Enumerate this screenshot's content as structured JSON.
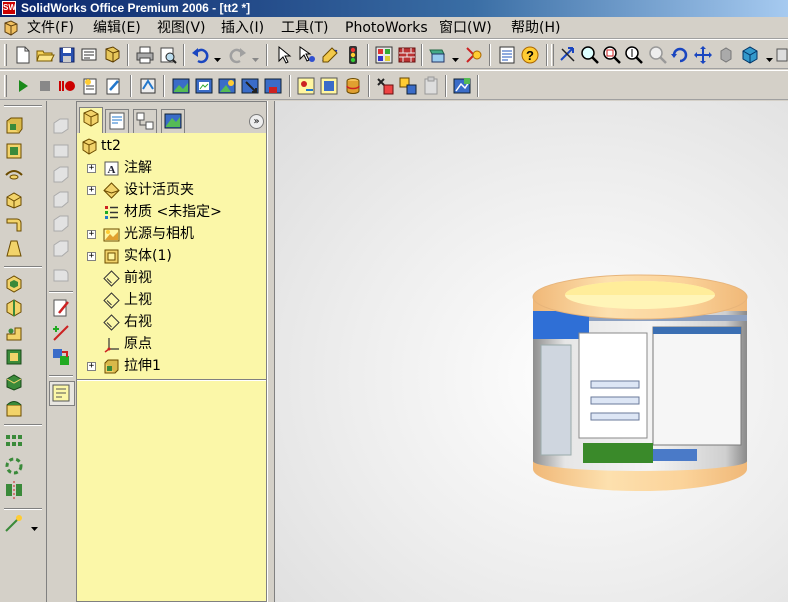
{
  "window": {
    "app_icon_text": "SW",
    "title": "SolidWorks Office Premium 2006 - [tt2 *]"
  },
  "menu": [
    {
      "label": "文件(F)"
    },
    {
      "label": "编辑(E)"
    },
    {
      "label": "视图(V)"
    },
    {
      "label": "插入(I)"
    },
    {
      "label": "工具(T)"
    },
    {
      "label": "PhotoWorks"
    },
    {
      "label": "窗口(W)"
    },
    {
      "label": "帮助(H)"
    }
  ],
  "feature_manager": {
    "chevron": "»",
    "root": "tt2",
    "items": [
      {
        "label": "注解",
        "expandable": true,
        "icon": "annotations-icon"
      },
      {
        "label": "设计活页夹",
        "expandable": true,
        "icon": "design-binder-icon"
      },
      {
        "label": "材质 <未指定>",
        "expandable": false,
        "icon": "material-icon"
      },
      {
        "label": "光源与相机",
        "expandable": true,
        "icon": "lights-cameras-icon"
      },
      {
        "label": "实体(1)",
        "expandable": true,
        "icon": "solid-bodies-icon"
      },
      {
        "label": "前视",
        "expandable": false,
        "icon": "plane-icon"
      },
      {
        "label": "上视",
        "expandable": false,
        "icon": "plane-icon"
      },
      {
        "label": "右视",
        "expandable": false,
        "icon": "plane-icon"
      },
      {
        "label": "原点",
        "expandable": false,
        "icon": "origin-icon"
      },
      {
        "label": "拉伸1",
        "expandable": true,
        "icon": "extrude-icon"
      }
    ]
  },
  "colors": {
    "feature_manager_bg": "#fbf7a8",
    "chrome": "#d4d0c8",
    "titlebar": "#0a246a",
    "model_cap": "#ffe8a0",
    "model_rim": "#f5c98a"
  }
}
